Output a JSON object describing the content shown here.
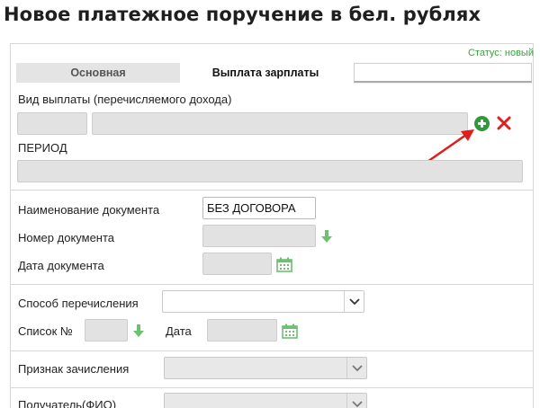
{
  "page": {
    "title": "Новое платежное поручение в бел. рублях"
  },
  "status": {
    "text": "Статус: новый"
  },
  "tabs": [
    {
      "label": "Основная"
    },
    {
      "label": "Выплата зарплаты"
    },
    {
      "label": ""
    }
  ],
  "payment_type": {
    "label": "Вид выплаты (перечисляемого дохода)",
    "code_value": "",
    "name_value": ""
  },
  "period": {
    "label": "ПЕРИОД",
    "value": ""
  },
  "document": {
    "name_label": "Наименование документа",
    "name_value": "БЕЗ ДОГОВОРА",
    "number_label": "Номер документа",
    "number_value": "",
    "date_label": "Дата документа",
    "date_value": ""
  },
  "transfer": {
    "method_label": "Способ перечисления",
    "method_value": "",
    "list_label": "Список №",
    "list_value": "",
    "date_label": "Дата",
    "date_value": ""
  },
  "credit_flag": {
    "label": "Признак зачисления",
    "value": ""
  },
  "recipient": {
    "label": "Получатель(ФИО)",
    "value": ""
  },
  "colors": {
    "accent_green": "#2e9a3a",
    "delete_red": "#e02020",
    "arrow_red": "#e21b1b",
    "status_green": "#3aa33a",
    "light_green_icon": "#6cc070"
  },
  "icons": [
    "add-icon",
    "delete-icon",
    "arrow-down-icon",
    "calendar-icon",
    "chevron-down-icon",
    "pointer-arrow"
  ]
}
